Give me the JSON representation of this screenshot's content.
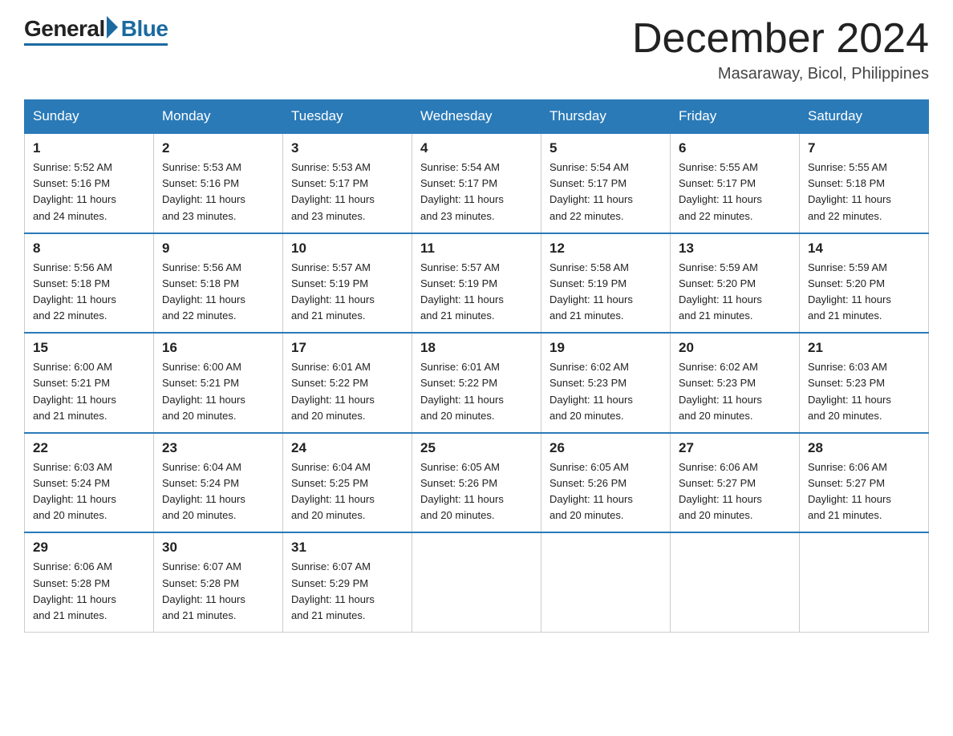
{
  "header": {
    "logo_general": "General",
    "logo_blue": "Blue",
    "month_title": "December 2024",
    "location": "Masaraway, Bicol, Philippines"
  },
  "days_of_week": [
    "Sunday",
    "Monday",
    "Tuesday",
    "Wednesday",
    "Thursday",
    "Friday",
    "Saturday"
  ],
  "weeks": [
    [
      {
        "day": "1",
        "sunrise": "5:52 AM",
        "sunset": "5:16 PM",
        "daylight": "11 hours and 24 minutes."
      },
      {
        "day": "2",
        "sunrise": "5:53 AM",
        "sunset": "5:16 PM",
        "daylight": "11 hours and 23 minutes."
      },
      {
        "day": "3",
        "sunrise": "5:53 AM",
        "sunset": "5:17 PM",
        "daylight": "11 hours and 23 minutes."
      },
      {
        "day": "4",
        "sunrise": "5:54 AM",
        "sunset": "5:17 PM",
        "daylight": "11 hours and 23 minutes."
      },
      {
        "day": "5",
        "sunrise": "5:54 AM",
        "sunset": "5:17 PM",
        "daylight": "11 hours and 22 minutes."
      },
      {
        "day": "6",
        "sunrise": "5:55 AM",
        "sunset": "5:17 PM",
        "daylight": "11 hours and 22 minutes."
      },
      {
        "day": "7",
        "sunrise": "5:55 AM",
        "sunset": "5:18 PM",
        "daylight": "11 hours and 22 minutes."
      }
    ],
    [
      {
        "day": "8",
        "sunrise": "5:56 AM",
        "sunset": "5:18 PM",
        "daylight": "11 hours and 22 minutes."
      },
      {
        "day": "9",
        "sunrise": "5:56 AM",
        "sunset": "5:18 PM",
        "daylight": "11 hours and 22 minutes."
      },
      {
        "day": "10",
        "sunrise": "5:57 AM",
        "sunset": "5:19 PM",
        "daylight": "11 hours and 21 minutes."
      },
      {
        "day": "11",
        "sunrise": "5:57 AM",
        "sunset": "5:19 PM",
        "daylight": "11 hours and 21 minutes."
      },
      {
        "day": "12",
        "sunrise": "5:58 AM",
        "sunset": "5:19 PM",
        "daylight": "11 hours and 21 minutes."
      },
      {
        "day": "13",
        "sunrise": "5:59 AM",
        "sunset": "5:20 PM",
        "daylight": "11 hours and 21 minutes."
      },
      {
        "day": "14",
        "sunrise": "5:59 AM",
        "sunset": "5:20 PM",
        "daylight": "11 hours and 21 minutes."
      }
    ],
    [
      {
        "day": "15",
        "sunrise": "6:00 AM",
        "sunset": "5:21 PM",
        "daylight": "11 hours and 21 minutes."
      },
      {
        "day": "16",
        "sunrise": "6:00 AM",
        "sunset": "5:21 PM",
        "daylight": "11 hours and 20 minutes."
      },
      {
        "day": "17",
        "sunrise": "6:01 AM",
        "sunset": "5:22 PM",
        "daylight": "11 hours and 20 minutes."
      },
      {
        "day": "18",
        "sunrise": "6:01 AM",
        "sunset": "5:22 PM",
        "daylight": "11 hours and 20 minutes."
      },
      {
        "day": "19",
        "sunrise": "6:02 AM",
        "sunset": "5:23 PM",
        "daylight": "11 hours and 20 minutes."
      },
      {
        "day": "20",
        "sunrise": "6:02 AM",
        "sunset": "5:23 PM",
        "daylight": "11 hours and 20 minutes."
      },
      {
        "day": "21",
        "sunrise": "6:03 AM",
        "sunset": "5:23 PM",
        "daylight": "11 hours and 20 minutes."
      }
    ],
    [
      {
        "day": "22",
        "sunrise": "6:03 AM",
        "sunset": "5:24 PM",
        "daylight": "11 hours and 20 minutes."
      },
      {
        "day": "23",
        "sunrise": "6:04 AM",
        "sunset": "5:24 PM",
        "daylight": "11 hours and 20 minutes."
      },
      {
        "day": "24",
        "sunrise": "6:04 AM",
        "sunset": "5:25 PM",
        "daylight": "11 hours and 20 minutes."
      },
      {
        "day": "25",
        "sunrise": "6:05 AM",
        "sunset": "5:26 PM",
        "daylight": "11 hours and 20 minutes."
      },
      {
        "day": "26",
        "sunrise": "6:05 AM",
        "sunset": "5:26 PM",
        "daylight": "11 hours and 20 minutes."
      },
      {
        "day": "27",
        "sunrise": "6:06 AM",
        "sunset": "5:27 PM",
        "daylight": "11 hours and 20 minutes."
      },
      {
        "day": "28",
        "sunrise": "6:06 AM",
        "sunset": "5:27 PM",
        "daylight": "11 hours and 21 minutes."
      }
    ],
    [
      {
        "day": "29",
        "sunrise": "6:06 AM",
        "sunset": "5:28 PM",
        "daylight": "11 hours and 21 minutes."
      },
      {
        "day": "30",
        "sunrise": "6:07 AM",
        "sunset": "5:28 PM",
        "daylight": "11 hours and 21 minutes."
      },
      {
        "day": "31",
        "sunrise": "6:07 AM",
        "sunset": "5:29 PM",
        "daylight": "11 hours and 21 minutes."
      },
      null,
      null,
      null,
      null
    ]
  ],
  "labels": {
    "sunrise": "Sunrise:",
    "sunset": "Sunset:",
    "daylight": "Daylight:"
  }
}
